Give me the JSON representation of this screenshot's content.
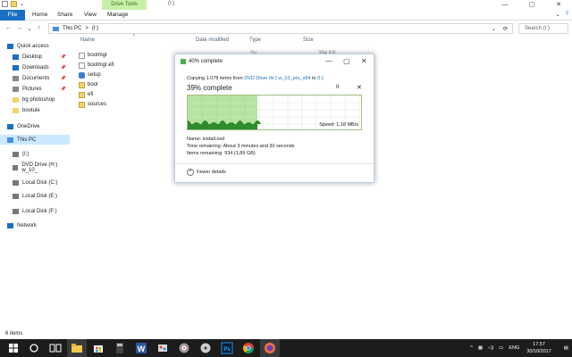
{
  "window": {
    "drive_tools_tab": "Drive Tools",
    "title": "(I:)",
    "controls": [
      "—",
      "▢",
      "✕"
    ]
  },
  "ribbon": {
    "tabs": [
      "File",
      "Home",
      "Share",
      "View",
      "Manage"
    ],
    "expand": "⌄",
    "help": "?"
  },
  "addressbar": {
    "back": "←",
    "forward": "→",
    "recent": "⌄",
    "up": "↑",
    "path": [
      "This PC",
      ">",
      "(I:)"
    ],
    "dropdown": "⌄",
    "refresh": "⟳",
    "search_placeholder": "Search (I:)"
  },
  "sidebar": {
    "items": [
      {
        "label": "Quick access",
        "icon": "star-icon",
        "pinned": false
      },
      {
        "label": "Desktop",
        "icon": "desktop-icon",
        "pinned": true
      },
      {
        "label": "Downloads",
        "icon": "download-icon",
        "pinned": true
      },
      {
        "label": "Documents",
        "icon": "documents-icon",
        "pinned": true
      },
      {
        "label": "Pictures",
        "icon": "pictures-icon",
        "pinned": true
      },
      {
        "label": "bg photoshop",
        "icon": "folder-icon",
        "pinned": false
      },
      {
        "label": "bootule",
        "icon": "folder-icon",
        "pinned": false
      },
      {
        "label": "OneDrive",
        "icon": "cloud-icon",
        "pinned": false
      },
      {
        "label": "This PC",
        "icon": "computer-icon",
        "pinned": false
      },
      {
        "label": "(I:)",
        "icon": "drive-icon",
        "pinned": false
      },
      {
        "label": "DVD Drive (H:) w_10_",
        "icon": "dvd-icon",
        "pinned": false
      },
      {
        "label": "Local Disk (C:)",
        "icon": "disk-icon",
        "pinned": false
      },
      {
        "label": "Local Disk (E:)",
        "icon": "disk-icon",
        "pinned": false
      },
      {
        "label": "Local Disk (F:)",
        "icon": "disk-icon",
        "pinned": false
      },
      {
        "label": "Network",
        "icon": "network-icon",
        "pinned": false
      }
    ],
    "pin_glyph": "📌"
  },
  "filelist": {
    "columns": [
      "Name",
      "Date modified",
      "Type",
      "Size"
    ],
    "sort_glyph": "^",
    "rows": [
      {
        "name": "bootmgr",
        "kind": "doc"
      },
      {
        "name": "bootmgr.efi",
        "kind": "doc"
      },
      {
        "name": "setup",
        "kind": "setup"
      },
      {
        "name": "boot",
        "kind": "folder"
      },
      {
        "name": "efi",
        "kind": "folder"
      },
      {
        "name": "sources",
        "kind": "folder"
      }
    ],
    "partial_type": "Sy",
    "partial_size": "394 KB"
  },
  "dialog": {
    "title": "40% complete",
    "controls": [
      "—",
      "▢",
      "✕"
    ],
    "copying_prefix": "Copying 1.078 items from ",
    "source": "DVD Drive (H:) w_10_pro_x64",
    "to": " to ",
    "dest": "(I:)",
    "percent_text": "39% complete",
    "progress": 0.4,
    "pause": "II",
    "stop": "✕",
    "speed": "Speed: 1,18 MB/s",
    "name_line": "Name: install.esd",
    "time_line": "Time remaining: About 3 minutes and 30 seconds",
    "items_line": "Items remaining: 934 (1,89 GB)",
    "fewer_details": "Fewer details",
    "fewer_glyph": "^"
  },
  "statusbar": {
    "text": "6 items"
  },
  "taskbar": {
    "lang": "ENG",
    "time": "17.57",
    "date": "30/10/2017"
  }
}
